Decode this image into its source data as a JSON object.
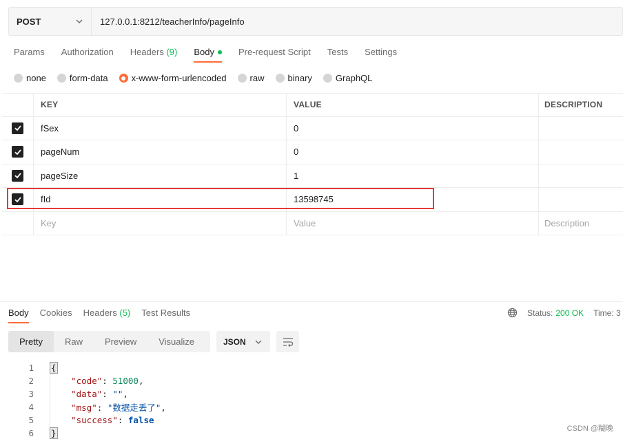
{
  "request": {
    "method": "POST",
    "url": "127.0.0.1:8212/teacherInfo/pageInfo"
  },
  "tabs": [
    {
      "label": "Params"
    },
    {
      "label": "Authorization"
    },
    {
      "label": "Headers",
      "count": "(9)"
    },
    {
      "label": "Body"
    },
    {
      "label": "Pre-request Script"
    },
    {
      "label": "Tests"
    },
    {
      "label": "Settings"
    }
  ],
  "body_types": [
    {
      "label": "none"
    },
    {
      "label": "form-data"
    },
    {
      "label": "x-www-form-urlencoded"
    },
    {
      "label": "raw"
    },
    {
      "label": "binary"
    },
    {
      "label": "GraphQL"
    }
  ],
  "selected_body_type": "x-www-form-urlencoded",
  "table": {
    "headers": {
      "key": "KEY",
      "value": "VALUE",
      "description": "DESCRIPTION"
    },
    "rows": [
      {
        "key": "fSex",
        "value": "0",
        "checked": true
      },
      {
        "key": "pageNum",
        "value": "0",
        "checked": true
      },
      {
        "key": "pageSize",
        "value": "1",
        "checked": true
      },
      {
        "key": "fId",
        "value": "13598745",
        "checked": true
      }
    ],
    "placeholders": {
      "key": "Key",
      "value": "Value",
      "description": "Description"
    }
  },
  "response": {
    "tabs": [
      {
        "label": "Body"
      },
      {
        "label": "Cookies"
      },
      {
        "label": "Headers",
        "count": "(5)"
      },
      {
        "label": "Test Results"
      }
    ],
    "status_label": "Status:",
    "status_value": "200 OK",
    "time_label": "Time: 3",
    "views": [
      "Pretty",
      "Raw",
      "Preview",
      "Visualize"
    ],
    "format": "JSON",
    "line_numbers": [
      "1",
      "2",
      "3",
      "4",
      "5",
      "6"
    ],
    "json": {
      "code_key": "\"code\"",
      "code_val": "51000",
      "data_key": "\"data\"",
      "data_val": "\"\"",
      "msg_key": "\"msg\"",
      "msg_val": "\"数据走丢了\"",
      "success_key": "\"success\"",
      "success_val": "false"
    }
  },
  "watermark": "CSDN @糊晚",
  "colors": {
    "accent": "#ff6c37",
    "success": "#0cbb52",
    "highlight": "#e53935"
  }
}
